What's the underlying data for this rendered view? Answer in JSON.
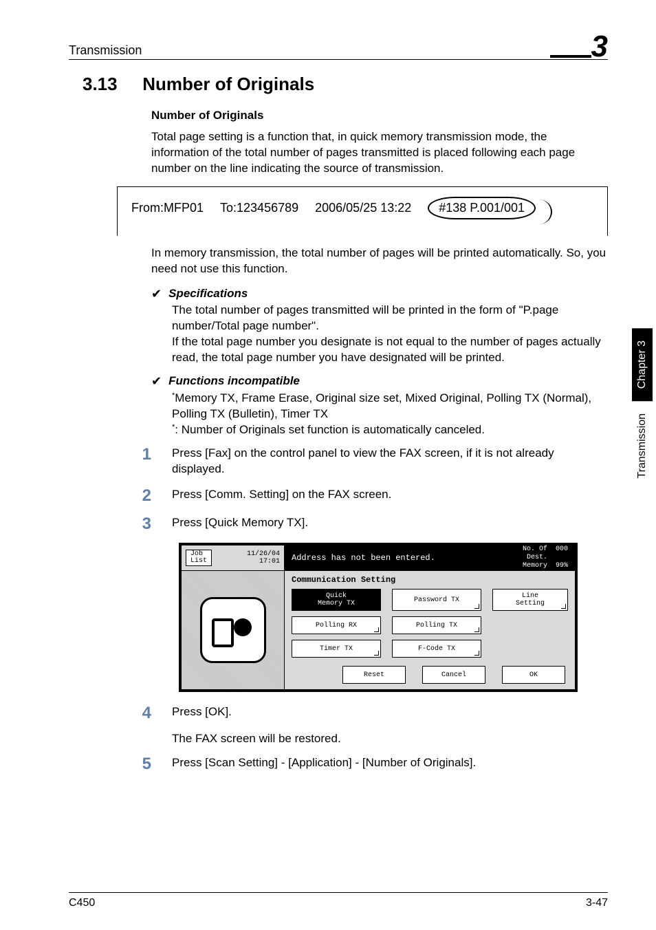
{
  "header": {
    "left": "Transmission",
    "chapterNum": "3"
  },
  "sideTab": {
    "chapter": "Chapter 3",
    "label": "Transmission"
  },
  "section": {
    "number": "3.13",
    "title": "Number of Originals"
  },
  "subTitle": "Number of Originals",
  "intro": "Total page setting is a function that, in quick memory transmission mode, the information of the total number of pages transmitted is placed following each page number on the line indicating the source of transmission.",
  "faxLine": {
    "from": "From:MFP01",
    "to": "To:123456789",
    "timestamp": "2006/05/25 13:22",
    "pageStamp": "#138 P.001/001"
  },
  "memoryNote": "In memory transmission, the total number of pages will be printed automatically. So, you need not use this function.",
  "specs": {
    "label": "Specifications",
    "line1": "The total number of pages transmitted will be printed in the form of \"P.page number/Total page number\".",
    "line2": "If the total page number you designate is not equal to the number of pages actually read, the total page number you have designated will be printed."
  },
  "incompat": {
    "label": "Functions incompatible",
    "line1": "Memory TX, Frame Erase, Original size set, Mixed Original, Polling TX (Normal), Polling TX (Bulletin), Timer TX",
    "line2": ": Number of Originals set function is automatically canceled."
  },
  "steps": {
    "s1": "Press [Fax] on the control panel to view the FAX screen, if it is not already displayed.",
    "s2": "Press [Comm. Setting] on the FAX screen.",
    "s3": "Press [Quick Memory TX].",
    "s4": "Press [OK].",
    "s4sub": "The FAX screen will be restored.",
    "s5": "Press [Scan Setting] - [Application] - [Number of Originals]."
  },
  "lcd": {
    "jobList": "Job\nList",
    "date": "11/26/04",
    "time": "17:01",
    "message": "Address has not been entered.",
    "destLabel": "No. Of\nDest.",
    "destCount": "000",
    "memoryLabel": "Memory",
    "memoryPct": "99%",
    "sectionTitle": "Communication Setting",
    "buttons": {
      "quickMemory": "Quick\nMemory TX",
      "passwordTX": "Password TX",
      "lineSetting": "Line\nSetting",
      "pollingRX": "Polling RX",
      "pollingTX": "Polling TX",
      "timerTX": "Timer TX",
      "fcodeTX": "F-Code TX",
      "reset": "Reset",
      "cancel": "Cancel",
      "ok": "OK"
    }
  },
  "footer": {
    "left": "C450",
    "right": "3-47"
  }
}
